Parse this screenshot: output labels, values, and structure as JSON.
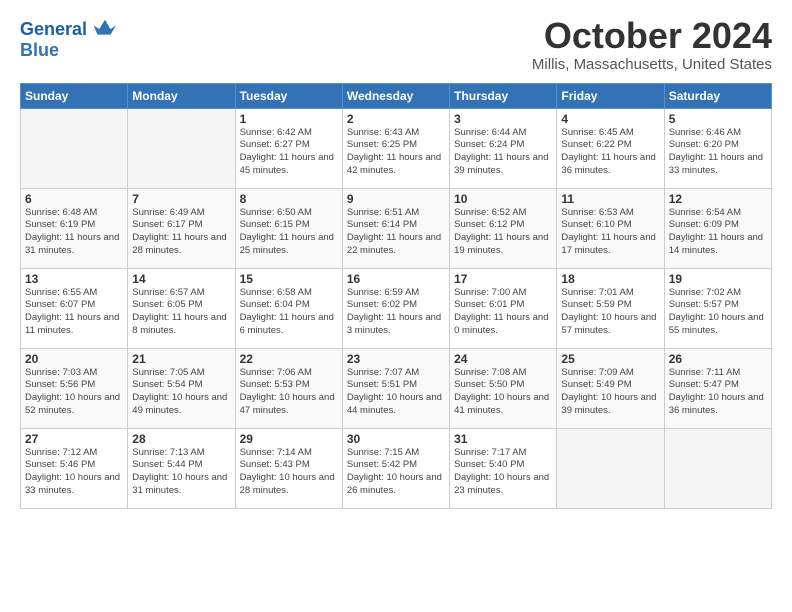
{
  "header": {
    "logo_line1": "General",
    "logo_line2": "Blue",
    "month": "October 2024",
    "location": "Millis, Massachusetts, United States"
  },
  "weekdays": [
    "Sunday",
    "Monday",
    "Tuesday",
    "Wednesday",
    "Thursday",
    "Friday",
    "Saturday"
  ],
  "weeks": [
    [
      {
        "day": "",
        "empty": true
      },
      {
        "day": "",
        "empty": true
      },
      {
        "day": "1",
        "sunrise": "6:42 AM",
        "sunset": "6:27 PM",
        "daylight": "11 hours and 45 minutes."
      },
      {
        "day": "2",
        "sunrise": "6:43 AM",
        "sunset": "6:25 PM",
        "daylight": "11 hours and 42 minutes."
      },
      {
        "day": "3",
        "sunrise": "6:44 AM",
        "sunset": "6:24 PM",
        "daylight": "11 hours and 39 minutes."
      },
      {
        "day": "4",
        "sunrise": "6:45 AM",
        "sunset": "6:22 PM",
        "daylight": "11 hours and 36 minutes."
      },
      {
        "day": "5",
        "sunrise": "6:46 AM",
        "sunset": "6:20 PM",
        "daylight": "11 hours and 33 minutes."
      }
    ],
    [
      {
        "day": "6",
        "sunrise": "6:48 AM",
        "sunset": "6:19 PM",
        "daylight": "11 hours and 31 minutes."
      },
      {
        "day": "7",
        "sunrise": "6:49 AM",
        "sunset": "6:17 PM",
        "daylight": "11 hours and 28 minutes."
      },
      {
        "day": "8",
        "sunrise": "6:50 AM",
        "sunset": "6:15 PM",
        "daylight": "11 hours and 25 minutes."
      },
      {
        "day": "9",
        "sunrise": "6:51 AM",
        "sunset": "6:14 PM",
        "daylight": "11 hours and 22 minutes."
      },
      {
        "day": "10",
        "sunrise": "6:52 AM",
        "sunset": "6:12 PM",
        "daylight": "11 hours and 19 minutes."
      },
      {
        "day": "11",
        "sunrise": "6:53 AM",
        "sunset": "6:10 PM",
        "daylight": "11 hours and 17 minutes."
      },
      {
        "day": "12",
        "sunrise": "6:54 AM",
        "sunset": "6:09 PM",
        "daylight": "11 hours and 14 minutes."
      }
    ],
    [
      {
        "day": "13",
        "sunrise": "6:55 AM",
        "sunset": "6:07 PM",
        "daylight": "11 hours and 11 minutes."
      },
      {
        "day": "14",
        "sunrise": "6:57 AM",
        "sunset": "6:05 PM",
        "daylight": "11 hours and 8 minutes."
      },
      {
        "day": "15",
        "sunrise": "6:58 AM",
        "sunset": "6:04 PM",
        "daylight": "11 hours and 6 minutes."
      },
      {
        "day": "16",
        "sunrise": "6:59 AM",
        "sunset": "6:02 PM",
        "daylight": "11 hours and 3 minutes."
      },
      {
        "day": "17",
        "sunrise": "7:00 AM",
        "sunset": "6:01 PM",
        "daylight": "11 hours and 0 minutes."
      },
      {
        "day": "18",
        "sunrise": "7:01 AM",
        "sunset": "5:59 PM",
        "daylight": "10 hours and 57 minutes."
      },
      {
        "day": "19",
        "sunrise": "7:02 AM",
        "sunset": "5:57 PM",
        "daylight": "10 hours and 55 minutes."
      }
    ],
    [
      {
        "day": "20",
        "sunrise": "7:03 AM",
        "sunset": "5:56 PM",
        "daylight": "10 hours and 52 minutes."
      },
      {
        "day": "21",
        "sunrise": "7:05 AM",
        "sunset": "5:54 PM",
        "daylight": "10 hours and 49 minutes."
      },
      {
        "day": "22",
        "sunrise": "7:06 AM",
        "sunset": "5:53 PM",
        "daylight": "10 hours and 47 minutes."
      },
      {
        "day": "23",
        "sunrise": "7:07 AM",
        "sunset": "5:51 PM",
        "daylight": "10 hours and 44 minutes."
      },
      {
        "day": "24",
        "sunrise": "7:08 AM",
        "sunset": "5:50 PM",
        "daylight": "10 hours and 41 minutes."
      },
      {
        "day": "25",
        "sunrise": "7:09 AM",
        "sunset": "5:49 PM",
        "daylight": "10 hours and 39 minutes."
      },
      {
        "day": "26",
        "sunrise": "7:11 AM",
        "sunset": "5:47 PM",
        "daylight": "10 hours and 36 minutes."
      }
    ],
    [
      {
        "day": "27",
        "sunrise": "7:12 AM",
        "sunset": "5:46 PM",
        "daylight": "10 hours and 33 minutes."
      },
      {
        "day": "28",
        "sunrise": "7:13 AM",
        "sunset": "5:44 PM",
        "daylight": "10 hours and 31 minutes."
      },
      {
        "day": "29",
        "sunrise": "7:14 AM",
        "sunset": "5:43 PM",
        "daylight": "10 hours and 28 minutes."
      },
      {
        "day": "30",
        "sunrise": "7:15 AM",
        "sunset": "5:42 PM",
        "daylight": "10 hours and 26 minutes."
      },
      {
        "day": "31",
        "sunrise": "7:17 AM",
        "sunset": "5:40 PM",
        "daylight": "10 hours and 23 minutes."
      },
      {
        "day": "",
        "empty": true
      },
      {
        "day": "",
        "empty": true
      }
    ]
  ]
}
